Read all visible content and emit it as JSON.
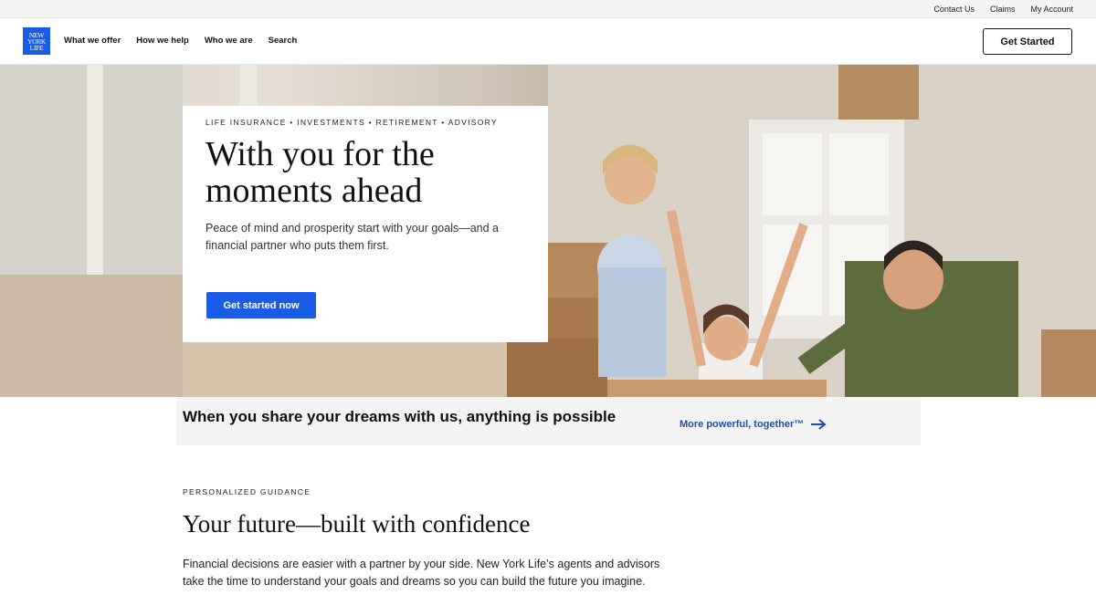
{
  "utility_nav": {
    "links": [
      "Contact Us",
      "Claims",
      "My Account"
    ]
  },
  "header": {
    "logo_lines": [
      "NEW",
      "YORK",
      "LIFE"
    ],
    "nav": [
      "What we offer",
      "How we help",
      "Who we are",
      "Search"
    ],
    "cta_label": "Get Started"
  },
  "hero": {
    "eyebrow": "LIFE INSURANCE • INVESTMENTS • RETIREMENT • ADVISORY",
    "title_line1": "With you for the",
    "title_line2": "moments ahead",
    "subtitle": "Peace of mind and prosperity start with your goals—and a financial partner who puts them first.",
    "cta_label": "Get started now"
  },
  "dream_bar": {
    "text": "When you share your dreams with us, anything is possible",
    "link_label": "More powerful, together™"
  },
  "guidance": {
    "eyebrow": "PERSONALIZED GUIDANCE",
    "title": "Your future—built with confidence",
    "body": "Financial decisions are easier with a partner by your side. New York Life’s agents and advisors take the time to understand your goals and dreams so you can build the future you imagine."
  },
  "colors": {
    "brand_blue": "#1a5ce6",
    "link_blue": "#1f4fa8",
    "text_dark": "#111111",
    "bar_gray": "#f4f4f4"
  },
  "icons": [
    "arrow-right-icon"
  ]
}
